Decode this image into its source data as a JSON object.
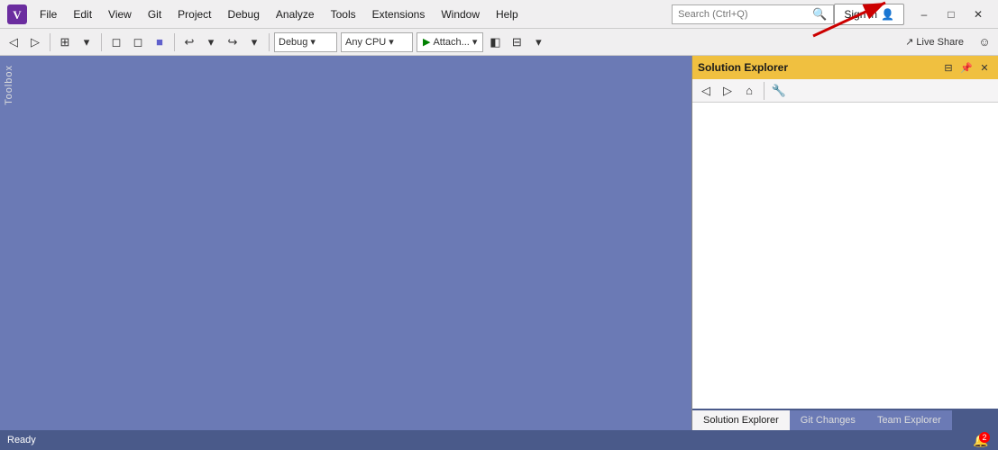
{
  "titlebar": {
    "menu_items": [
      "File",
      "Edit",
      "View",
      "Git",
      "Project",
      "Debug",
      "Analyze",
      "Tools",
      "Extensions",
      "Window",
      "Help"
    ],
    "search_placeholder": "Search (Ctrl+Q)",
    "sign_in_label": "Sign in",
    "window_controls": [
      "–",
      "□",
      "✕"
    ]
  },
  "toolbar": {
    "debug_dropdown": "Debug",
    "cpu_dropdown": "Any CPU",
    "attach_label": "Attach...",
    "live_share_label": "Live Share",
    "undo_icon": "↩",
    "redo_icon": "↪"
  },
  "toolbox": {
    "label": "Toolbox"
  },
  "solution_explorer": {
    "title": "Solution Explorer",
    "panel_controls": [
      "▾",
      "⊡",
      "✕"
    ]
  },
  "panel_tabs": [
    {
      "label": "Solution Explorer",
      "active": true
    },
    {
      "label": "Git Changes",
      "active": false
    },
    {
      "label": "Team Explorer",
      "active": false
    }
  ],
  "status_bar": {
    "text": "Ready",
    "notification_count": "2"
  }
}
